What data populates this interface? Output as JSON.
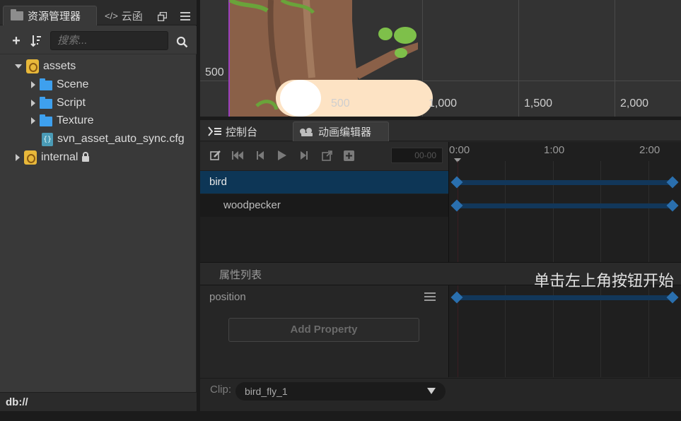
{
  "assets_panel": {
    "tab_active_label": "资源管理器",
    "tab_inactive_label": "云函",
    "search_placeholder": "搜索...",
    "tree": [
      {
        "label": "assets"
      },
      {
        "label": "Scene"
      },
      {
        "label": "Script"
      },
      {
        "label": "Texture"
      },
      {
        "label": "svn_asset_auto_sync.cfg"
      },
      {
        "label": "internal"
      }
    ],
    "footer": "db://",
    "file_icon_glyph": "{}"
  },
  "scene_view": {
    "y_label": "500",
    "x_labels": [
      "500",
      "1,000",
      "1,500",
      "2,000"
    ]
  },
  "anim_editor": {
    "tab_console": "控制台",
    "tab_animation": "动画编辑器",
    "time_value": "00-00",
    "ruler": [
      "0:00",
      "1:00",
      "2:00"
    ],
    "nodes": [
      {
        "label": "bird"
      },
      {
        "label": "woodpecker"
      }
    ],
    "props_title": "属性列表",
    "hint": "单击左上角按钮开始",
    "property": "position",
    "add_property": "Add Property",
    "clip_label": "Clip:",
    "clip_value": "bird_fly_1"
  },
  "colors": {
    "accent_selected": "#0d3656",
    "keyframe": "#2a6fae",
    "track": "#12375a"
  }
}
